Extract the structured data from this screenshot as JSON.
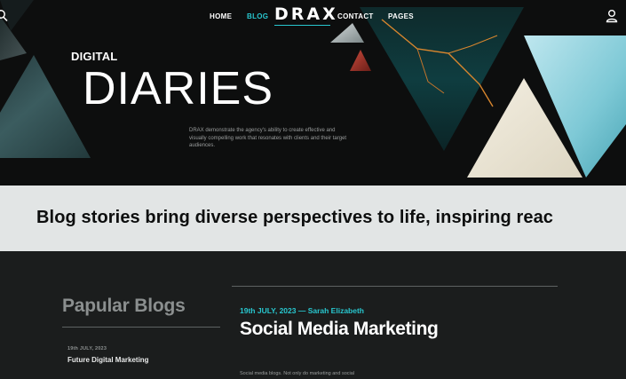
{
  "nav": {
    "links": [
      {
        "label": "HOME"
      },
      {
        "label": "BLOG"
      },
      {
        "label": "CONTACT"
      },
      {
        "label": "PAGES"
      }
    ],
    "logo": "DRAX",
    "accent_color": "#28c7cf",
    "search_icon": "search-icon",
    "user_icon": "user-icon"
  },
  "hero": {
    "kicker": "DIGITAL",
    "title": "DIARIES",
    "description": "DRAX demonstrate the agency's ability to create effective and visually compelling work that resonates with clients and their target audiences."
  },
  "band": {
    "text": "Blog stories bring diverse perspectives to life, inspiring reac"
  },
  "sidebar": {
    "title": "Papular Blogs",
    "items": [
      {
        "date": "19th JULY, 2023",
        "title": "Future Digital Marketing"
      }
    ]
  },
  "post": {
    "meta": "19th JULY, 2023 — Sarah Elizabeth",
    "title": "Social Media Marketing",
    "excerpt": "Social media blogs. Not only do marketing and social"
  },
  "colors": {
    "background": "#0d0e0e",
    "band": "#e2e5e5",
    "content": "#1b1d1d",
    "accent": "#28c7cf"
  }
}
